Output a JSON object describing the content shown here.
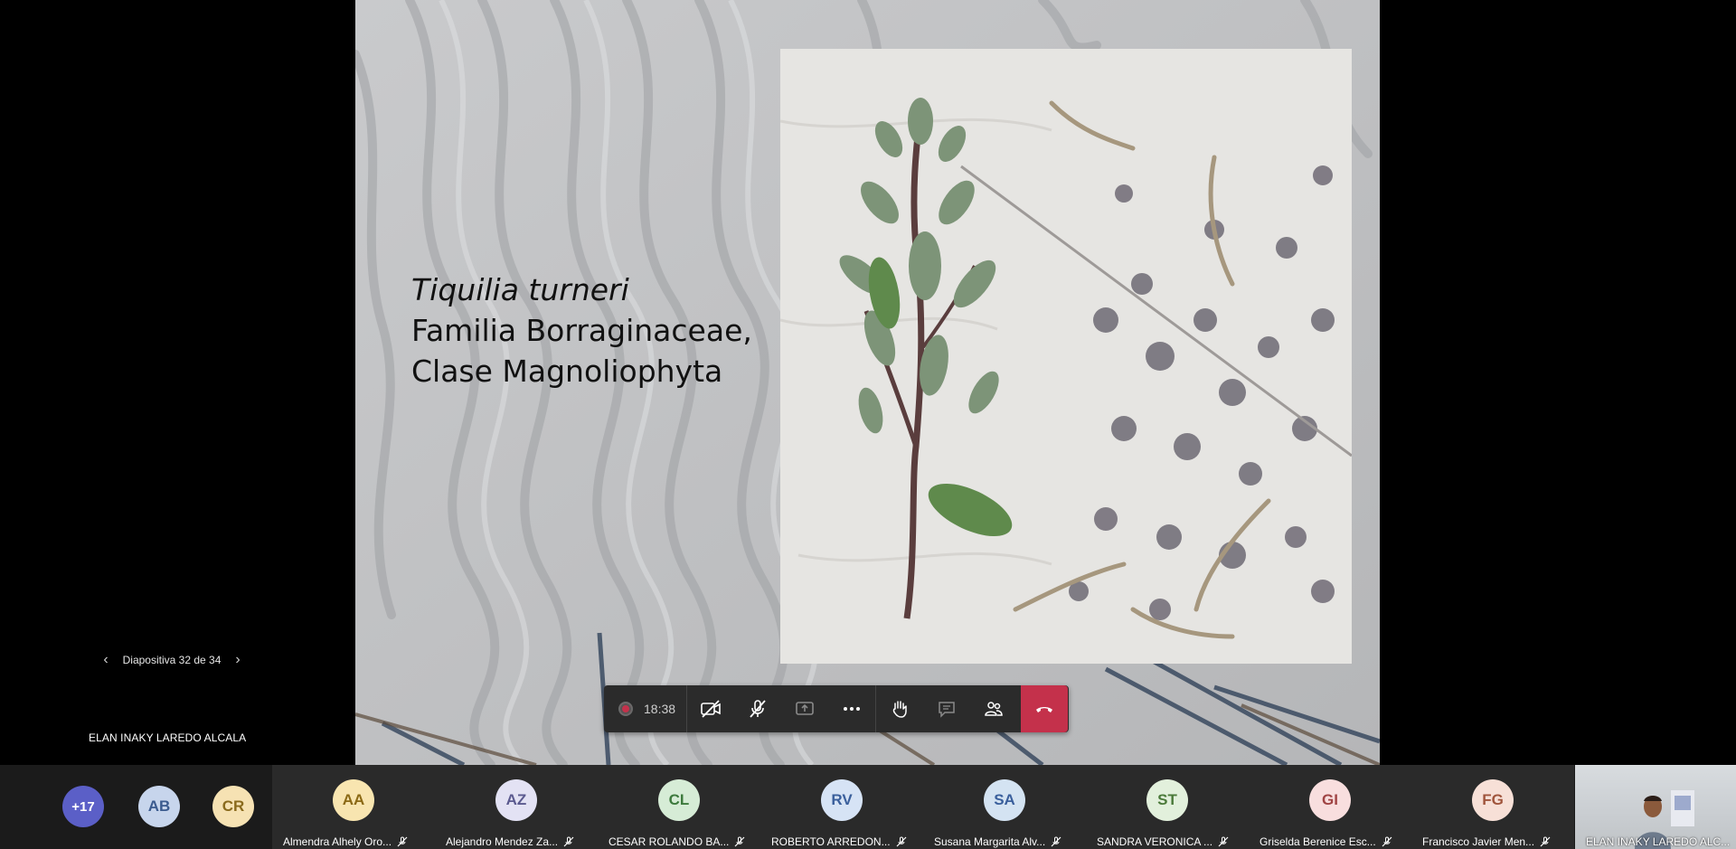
{
  "slide": {
    "title_italic": "Tiquilia turneri",
    "line2": "Familia Borraginaceae,",
    "line3": "Clase Magnoliophyta"
  },
  "slide_nav": {
    "label": "Diapositiva 32 de 34",
    "prev_icon": "chevron-left-icon",
    "next_icon": "chevron-right-icon"
  },
  "presenter_name": "ELAN INAKY LAREDO ALCALA",
  "controls": {
    "recording_time": "18:38",
    "buttons": [
      "video-off-icon",
      "mic-off-icon",
      "share-icon",
      "more-icon",
      "raise-hand-icon",
      "chat-icon",
      "participants-icon",
      "hang-up-icon"
    ],
    "hangup_color": "#c4314b"
  },
  "participants": {
    "overflow": "+17",
    "small": [
      {
        "initials": "AB",
        "color": "#c7d5ec",
        "text_color": "#3b5b8f"
      },
      {
        "initials": "CR",
        "color": "#f6e2b3",
        "text_color": "#8a6a1c"
      }
    ],
    "tiles": [
      {
        "initials": "AA",
        "name": "Almendra Alhely Oro...",
        "color": "#f8e5b0",
        "text_color": "#8b6914"
      },
      {
        "initials": "AZ",
        "name": "Alejandro Mendez Za...",
        "color": "#e3e2f4",
        "text_color": "#5b5a8f"
      },
      {
        "initials": "CL",
        "name": "CESAR ROLANDO BA...",
        "color": "#d6ecd6",
        "text_color": "#3d7a3d"
      },
      {
        "initials": "RV",
        "name": "ROBERTO ARREDON...",
        "color": "#d6e3f5",
        "text_color": "#3a5f9c"
      },
      {
        "initials": "SA",
        "name": "Susana Margarita Alv...",
        "color": "#d4e3f2",
        "text_color": "#3a5f9c"
      },
      {
        "initials": "ST",
        "name": "SANDRA VERONICA ...",
        "color": "#e2f0dc",
        "text_color": "#4b7a3a"
      },
      {
        "initials": "GI",
        "name": "Griselda Berenice Esc...",
        "color": "#f8dede",
        "text_color": "#a04444"
      },
      {
        "initials": "FG",
        "name": "Francisco Javier Men...",
        "color": "#f7e0d7",
        "text_color": "#a0553c"
      }
    ],
    "self_name": "ELAN INAKY LAREDO ALC..."
  }
}
